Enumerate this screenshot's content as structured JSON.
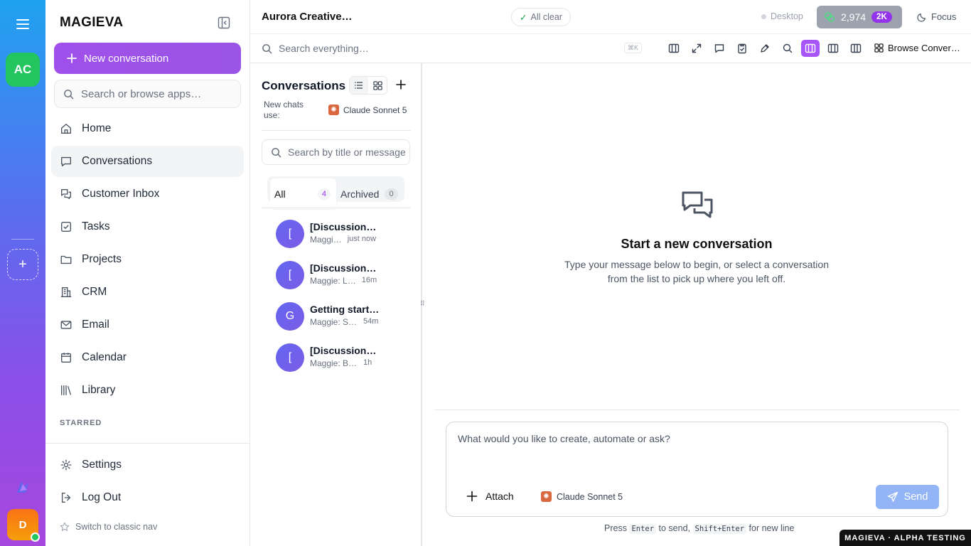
{
  "rail": {
    "workspace_initials": "AC",
    "add_symbol": "+",
    "user_initial": "D",
    "menu_icon": "hamburger-icon",
    "logo_icon": "app-logo-icon"
  },
  "sidebar": {
    "brand": "MAGIEVA",
    "new_conversation": "New conversation",
    "search_placeholder": "Search or browse apps…",
    "items": [
      {
        "label": "Home",
        "icon": "home-icon"
      },
      {
        "label": "Conversations",
        "icon": "chat-icon"
      },
      {
        "label": "Customer Inbox",
        "icon": "inbox-icon"
      },
      {
        "label": "Tasks",
        "icon": "checkbox-icon"
      },
      {
        "label": "Projects",
        "icon": "folder-icon"
      },
      {
        "label": "CRM",
        "icon": "building-icon"
      },
      {
        "label": "Email",
        "icon": "mail-icon"
      },
      {
        "label": "Calendar",
        "icon": "calendar-icon"
      },
      {
        "label": "Library",
        "icon": "library-icon"
      }
    ],
    "starred_heading": "STARRED",
    "settings": "Settings",
    "logout": "Log Out",
    "classic_nav": "Switch to classic nav"
  },
  "topbar": {
    "workspace_title": "Aurora Creative…",
    "status": "All clear",
    "status_check": "✓",
    "desktop": "Desktop",
    "credits": "2,974",
    "credits_badge": "2K",
    "focus": "Focus"
  },
  "toolbar": {
    "search_placeholder": "Search everything…",
    "shortcut": "⌘K",
    "browse": "Browse Conver…"
  },
  "conversations": {
    "title": "Conversations",
    "new_chats_label": "New chats use:",
    "model": "Claude Sonnet 5",
    "search_placeholder": "Search by title or message",
    "tabs": [
      {
        "label": "All",
        "count": "4"
      },
      {
        "label": "Archived",
        "count": "0"
      }
    ],
    "items": [
      {
        "initial": "[",
        "title": "[Discussion…",
        "preview": "Maggi…",
        "time": "just now"
      },
      {
        "initial": "[",
        "title": "[Discussion…",
        "preview": "Maggie: L…",
        "time": "16m"
      },
      {
        "initial": "G",
        "title": "Getting start…",
        "preview": "Maggie: St…",
        "time": "54m"
      },
      {
        "initial": "[",
        "title": "[Discussion…",
        "preview": "Maggie: By t…",
        "time": "1h"
      }
    ]
  },
  "main": {
    "empty_title": "Start a new conversation",
    "empty_desc_1": "Type your message below to begin, or select a conversation",
    "empty_desc_2": "from the list to pick up where you left off."
  },
  "composer": {
    "placeholder": "What would you like to create, automate or ask?",
    "attach": "Attach",
    "model": "Claude Sonnet 5",
    "send": "Send",
    "hint_press": "Press",
    "hint_enter": "Enter",
    "hint_to_send": "to send,",
    "hint_shift": "Shift+Enter",
    "hint_newline": "for new line"
  },
  "footer_badge": "MAGIEVA · ALPHA TESTING",
  "colors": {
    "accent": "#a050ea",
    "avatar": "#6366f1",
    "workspace": "#22c55e",
    "user": "#f59e0b",
    "send": "#93b5f5"
  }
}
